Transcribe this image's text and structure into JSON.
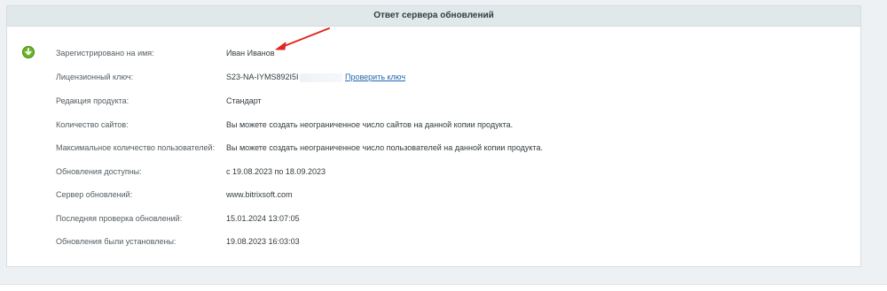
{
  "panel": {
    "title": "Ответ сервера обновлений"
  },
  "status_icon": "download-ok-icon",
  "rows": [
    {
      "label": "Зарегистрировано на имя:",
      "value": "Иван Иванов"
    },
    {
      "label": "Лицензионный ключ:",
      "value": "S23-NA-IYMS892I5I",
      "link": "Проверить ключ"
    },
    {
      "label": "Редакция продукта:",
      "value": "Стандарт"
    },
    {
      "label": "Количество сайтов:",
      "value": "Вы можете создать неограниченное число сайтов на данной копии продукта."
    },
    {
      "label": "Максимальное количество пользователей:",
      "value": "Вы можете создать неограниченное число пользователей на данной копии продукта."
    },
    {
      "label": "Обновления доступны:",
      "value": "с 19.08.2023 по 18.09.2023"
    },
    {
      "label": "Сервер обновлений:",
      "value": "www.bitrixsoft.com"
    },
    {
      "label": "Последняя проверка обновлений:",
      "value": "15.01.2024 13:07:05"
    },
    {
      "label": "Обновления были установлены:",
      "value": "19.08.2023 16:03:03"
    }
  ],
  "colors": {
    "header_bg": "#e0e8ea",
    "link": "#2067b0",
    "status_green": "#6ab42a",
    "annotation_arrow": "#e0281e"
  }
}
